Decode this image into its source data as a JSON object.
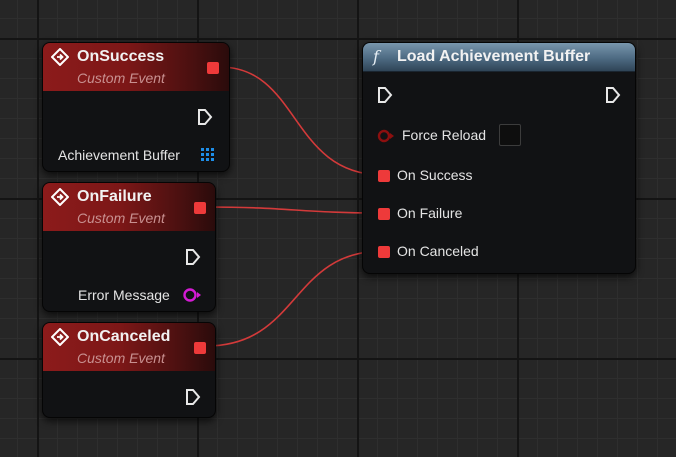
{
  "events": [
    {
      "title": "OnSuccess",
      "subtitle": "Custom Event",
      "output_pin": "Achievement Buffer"
    },
    {
      "title": "OnFailure",
      "subtitle": "Custom Event",
      "output_pin": "Error Message"
    },
    {
      "title": "OnCanceled",
      "subtitle": "Custom Event"
    }
  ],
  "function": {
    "icon": "f",
    "title": "Load Achievement Buffer",
    "force_reload_label": "Force Reload",
    "force_reload_checked": false,
    "on_success_label": "On Success",
    "on_failure_label": "On Failure",
    "on_canceled_label": "On Canceled"
  },
  "colors": {
    "event_header": "#8c1b1b",
    "function_header": "#5c7a92",
    "delegate_pin": "#ee3a3a",
    "wire": "#d33a3a",
    "array_pin": "#1e8ee8",
    "text_pin": "#d41bd4"
  }
}
